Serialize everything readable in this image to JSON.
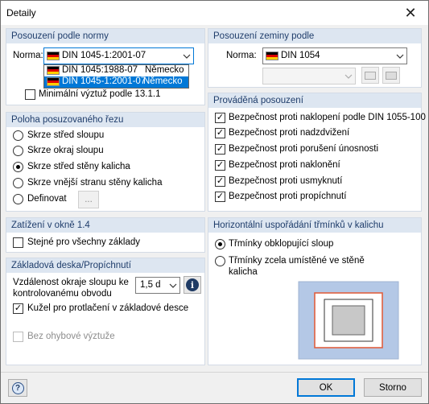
{
  "window": {
    "title": "Detaily",
    "close_symbol": "✕"
  },
  "norm_panel": {
    "title": "Posouzení podle normy",
    "norm_label": "Norma:",
    "selected": "DIN 1045-1:2001-07",
    "options": [
      {
        "code": "DIN 1045:1988-07",
        "country": "Německo",
        "selected": false
      },
      {
        "code": "DIN 1045-1:2001-07",
        "country": "Německo",
        "selected": true
      }
    ],
    "min_reinf_label": "Minimální výztuž podle 13.1.1",
    "min_reinf_checked": false
  },
  "soil_panel": {
    "title": "Posouzení zeminy podle",
    "norm_label": "Norma:",
    "selected": "DIN 1054"
  },
  "checks_panel": {
    "title": "Prováděná posouzení",
    "items": [
      {
        "label": "Bezpečnost proti naklopení podle DIN 1055-100",
        "checked": true
      },
      {
        "label": "Bezpečnost proti nadzdvižení",
        "checked": true
      },
      {
        "label": "Bezpečnost proti porušení únosnosti",
        "checked": true
      },
      {
        "label": "Bezpečnost proti naklonění",
        "checked": true
      },
      {
        "label": "Bezpečnost proti usmyknutí",
        "checked": true
      },
      {
        "label": "Bezpečnost proti propíchnutí",
        "checked": true
      }
    ]
  },
  "section_panel": {
    "title": "Poloha posuzovaného řezu",
    "options": [
      {
        "label": "Skrze střed sloupu",
        "selected": false
      },
      {
        "label": "Skrze okraj sloupu",
        "selected": false
      },
      {
        "label": "Skrze střed stěny kalicha",
        "selected": true
      },
      {
        "label": "Skrze vnější stranu stěny kalicha",
        "selected": false
      },
      {
        "label": "Definovat",
        "selected": false
      }
    ],
    "define_button": "..."
  },
  "load_panel": {
    "title": "Zatížení v okně 1.4",
    "same_label": "Stejné pro všechny základy",
    "same_checked": false
  },
  "stirrups_panel": {
    "title": "Horizontální uspořádání třmínků v kalichu",
    "options": [
      {
        "label": "Třmínky obklopující sloup",
        "selected": true
      },
      {
        "label": "Třmínky zcela umístěné ve stěně kalicha",
        "selected": false
      }
    ],
    "colors": {
      "outer": "#b4c8e6",
      "stirrup": "#e06040",
      "column": "#c8c8c8"
    }
  },
  "slab_panel": {
    "title": "Základová deska/Propíchnutí",
    "distance_label": "Vzdálenost okraje sloupu ke kontrolovanému obvodu",
    "distance_value": "1,5 d",
    "kuzel_label": "Kužel pro protlačení v základové desce",
    "kuzel_checked": true,
    "no_bending_label": "Bez ohybové výztuže",
    "no_bending_checked": false
  },
  "footer": {
    "ok": "OK",
    "cancel": "Storno"
  }
}
